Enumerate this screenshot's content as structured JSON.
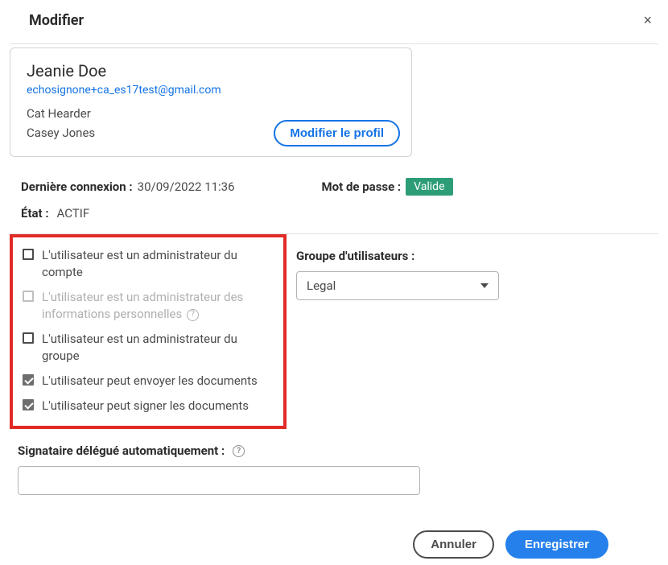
{
  "dialog": {
    "title": "Modifier",
    "close_symbol": "×"
  },
  "profile": {
    "name": "Jeanie Doe",
    "email": "echosignone+ca_es17test@gmail.com",
    "meta1": "Cat Hearder",
    "meta2": "Casey Jones",
    "edit_button": "Modifier le profil"
  },
  "meta": {
    "last_login_label": "Dernière connexion :",
    "last_login_value": "30/09/2022 11:36",
    "password_label": "Mot de passe :",
    "password_badge": "Valide",
    "state_label": "État :",
    "state_value": "ACTIF"
  },
  "permissions": {
    "account_admin": "L'utilisateur est un administrateur du compte",
    "personal_info_admin": "L'utilisateur est un administrateur des informations personnelles",
    "group_admin": "L'utilisateur est un administrateur du groupe",
    "can_send": "L'utilisateur peut envoyer les documents",
    "can_sign": "L'utilisateur peut signer les documents"
  },
  "group": {
    "label": "Groupe d'utilisateurs :",
    "value": "Legal"
  },
  "delegate": {
    "label": "Signataire délégué automatiquement :",
    "value": ""
  },
  "footer": {
    "cancel": "Annuler",
    "save": "Enregistrer"
  }
}
